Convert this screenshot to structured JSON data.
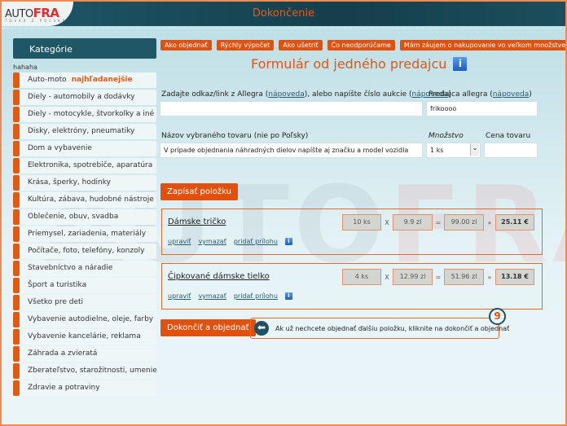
{
  "header": {
    "logo_auto": "AUTO",
    "logo_fra": "FRA",
    "logo_sub": "TOVAR Z POĽSKA",
    "title": "Dokončenie"
  },
  "watermark": {
    "a": "AUTO",
    "b": "FRA"
  },
  "sidebar": {
    "title": "Kategórie",
    "note": "hahaha",
    "items": [
      {
        "label": "Auto-moto",
        "hot": "najhľadanejšie"
      },
      {
        "label": "Diely - automobily a dodávky"
      },
      {
        "label": "Diely - motocykle, štvorkolky a iné"
      },
      {
        "label": "Disky, elektróny, pneumatiky"
      },
      {
        "label": "Dom a vybavenie"
      },
      {
        "label": "Elektronika, spotrebiče, aparatúra"
      },
      {
        "label": "Krása, šperky, hodinky"
      },
      {
        "label": "Kultúra, zábava, hudobné nástroje"
      },
      {
        "label": "Oblečenie, obuv, svadba"
      },
      {
        "label": "Priemysel, zariadenia, materiály"
      },
      {
        "label": "Počítače, foto, telefóny, konzoly"
      },
      {
        "label": "Stavebníctvo a náradie"
      },
      {
        "label": "Šport a turistika"
      },
      {
        "label": "Všetko pre deti"
      },
      {
        "label": "Vybavenie autodielne, oleje, farby"
      },
      {
        "label": "Vybavenie kancelárie, reklama"
      },
      {
        "label": "Záhrada a zvieratá"
      },
      {
        "label": "Zberateľstvo, starožitnosti, umenie"
      },
      {
        "label": "Zdravie a potraviny"
      }
    ]
  },
  "topbuttons": [
    "Ako objednať",
    "Rýchly výpočet",
    "Ako ušetriť",
    "Čo neodporúčame",
    "Mám záujem o nakupovanie vo veľkom množstve"
  ],
  "form": {
    "title": "Formulár od jedného predajcu",
    "info_icon": "i",
    "link_label_a": "Zadajte odkaz/link z Allegra (",
    "help": "nápoveda",
    "link_label_b": "), alebo napíšte číslo aukcie (",
    "close": ")",
    "link_value": "",
    "seller_label": "Predajca allegra (",
    "seller_value": "frikoooo",
    "name_label": "Názov vybraného tovaru (nie po Poľsky)",
    "name_value": "V prípade objednania náhradných dielov napíšte aj značku a model vozidla",
    "qty_label": "Množstvo",
    "qty_value": "1 ks",
    "price_label": "Cena tovaru",
    "price_value": "",
    "add_button": "Zapísať položku"
  },
  "items": [
    {
      "name": "Dámske tričko",
      "qty": "10 ks",
      "price": "9.9 zl",
      "sum": "99.00 zl",
      "total": "25.11 €"
    },
    {
      "name": "Čipkované dámske tielko",
      "qty": "4 ks",
      "price": "12.99 zl",
      "sum": "51.96 zl",
      "total": "13.18 €"
    }
  ],
  "item_links": {
    "edit": "upraviť",
    "delete": "vymazať",
    "attach": "pridať prílohu"
  },
  "ops": {
    "x": "X",
    "eq": "=",
    "arrow": "»"
  },
  "finish": {
    "button": "Dokončiť a objednať",
    "hint": "Ak už nechcete objednať ďalšiu položku, kliknite na dokončiť a objednať",
    "step": "9",
    "arrow_icon": "⬅"
  }
}
